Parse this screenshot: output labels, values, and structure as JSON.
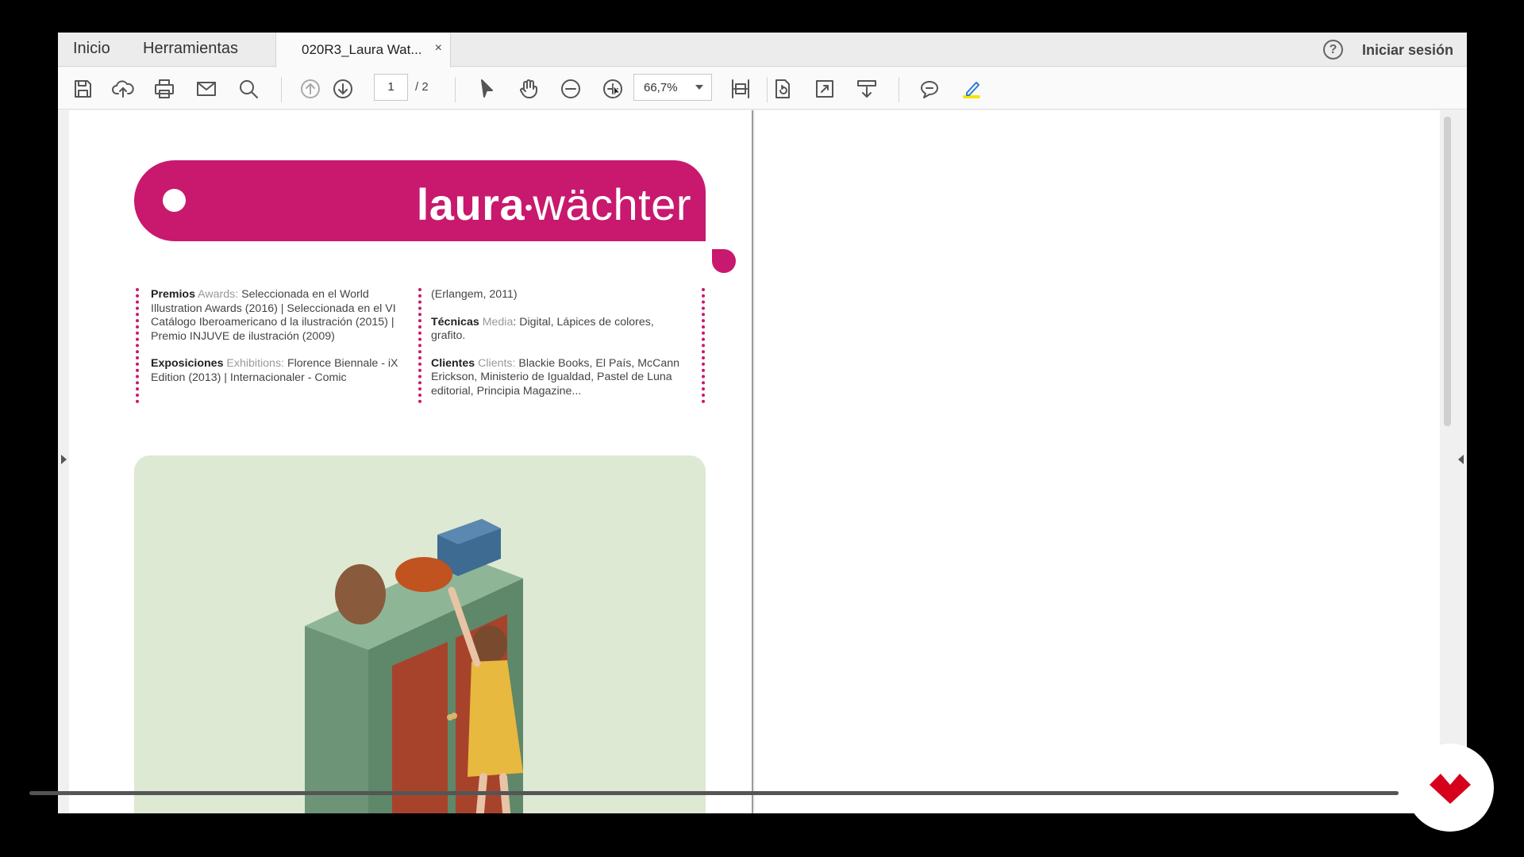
{
  "nav": {
    "home": "Inicio",
    "tools": "Herramientas",
    "tab_title": "020R3_Laura Wat...",
    "tab_close": "×",
    "help_glyph": "?",
    "signin": "Iniciar sesión"
  },
  "toolbar": {
    "icons": [
      "save-icon",
      "upload-icon",
      "print-icon",
      "email-icon",
      "search-icon",
      "page-up-icon",
      "page-down-icon",
      "select-cursor-icon",
      "hand-icon",
      "zoom-out-icon",
      "zoom-in-icon",
      "fit-page-icon",
      "rotate-icon",
      "fullscreen-icon",
      "scroll-mode-icon",
      "comment-icon",
      "highlight-icon"
    ],
    "page_current": "1",
    "page_total": "/ 2",
    "zoom": "66,7%"
  },
  "document": {
    "name_bold": "laura",
    "name_separator": "•",
    "name_rest": "wächter",
    "col1": {
      "awards_label": "Premios",
      "awards_en": "Awards:",
      "awards_text": "Seleccionada en el World Illustration Awards (2016) | Seleccionada en el VI Catálogo Iberoamericano d la ilustración (2015) | Premio INJUVE de ilustración (2009)",
      "exhibitions_label": "Exposiciones",
      "exhibitions_en": "Exhibitions:",
      "exhibitions_text": "Florence Biennale - iX Edition (2013) | Internacionaler - Comic"
    },
    "col2": {
      "continued": "(Erlangem, 2011)",
      "media_label": "Técnicas",
      "media_en": "Media",
      "media_text": ": Digital, Lápices de colores, grafito.",
      "clients_label": "Clientes",
      "clients_en": "Clients:",
      "clients_text": "Blackie Books, El País, McCann Erickson, Ministerio de Igualdad, Pastel de Luna editorial, Principia Magazine..."
    }
  },
  "colors": {
    "brand_magenta": "#c8196e",
    "illustration_bg": "#dde9d3",
    "badge_red": "#d6001c"
  }
}
